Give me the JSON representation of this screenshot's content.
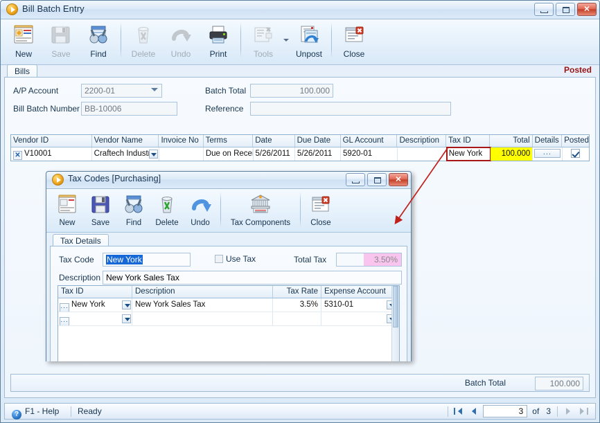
{
  "main_window": {
    "title": "Bill Batch Entry",
    "icon": "app-play-icon",
    "window_controls": {
      "minimize": "–",
      "maximize": "□",
      "close": "✕"
    },
    "toolbar": [
      {
        "label": "New",
        "icon": "new-document-icon",
        "disabled": false
      },
      {
        "label": "Save",
        "icon": "floppy-save-icon",
        "disabled": true
      },
      {
        "label": "Find",
        "icon": "binoculars-icon",
        "disabled": false
      },
      {
        "label": "Delete",
        "icon": "trash-delete-icon",
        "disabled": true
      },
      {
        "label": "Undo",
        "icon": "undo-arrow-icon",
        "disabled": true
      },
      {
        "label": "Print",
        "icon": "printer-icon",
        "disabled": false
      },
      {
        "label": "Tools",
        "icon": "tools-icon",
        "disabled": true
      },
      {
        "label": "Unpost",
        "icon": "unpost-icon",
        "disabled": false
      },
      {
        "label": "Close",
        "icon": "close-window-icon",
        "disabled": false
      }
    ]
  },
  "tab": {
    "label": "Bills",
    "status_flag": "Posted"
  },
  "form": {
    "ap_account_label": "A/P Account",
    "ap_account_value": "2200-01",
    "bill_batch_number_label": "Bill Batch Number",
    "bill_batch_number_value": "BB-10006",
    "batch_total_label": "Batch Total",
    "batch_total_value": "100.000",
    "reference_label": "Reference",
    "reference_value": ""
  },
  "grid": {
    "columns": [
      "Vendor ID",
      "Vendor Name",
      "Invoice No",
      "Terms",
      "Date",
      "Due Date",
      "GL Account",
      "Description",
      "Tax ID",
      "Total",
      "Details",
      "Posted"
    ],
    "rows": [
      {
        "vendor_id": "V10001",
        "vendor_name": "Craftech Industri",
        "invoice_no": "",
        "terms": "Due on Recei",
        "date": "5/26/2011",
        "due_date": "5/26/2011",
        "gl_account": "5920-01",
        "description": "",
        "tax_id": "New York",
        "total": "100.000",
        "details": "...",
        "posted": true
      }
    ]
  },
  "footer": {
    "batch_total_label": "Batch Total",
    "batch_total_value": "100.000"
  },
  "statusbar": {
    "help": "F1 - Help",
    "state": "Ready",
    "nav": {
      "first": "|◀",
      "prev": "◀",
      "current": "3",
      "of_label": "of",
      "total": "3",
      "next": "▶",
      "last": "▶|"
    }
  },
  "dialog": {
    "title": "Tax Codes [Purchasing]",
    "icon": "app-play-icon",
    "toolbar": [
      {
        "label": "New",
        "icon": "new-document-icon",
        "disabled": false
      },
      {
        "label": "Save",
        "icon": "floppy-save-icon",
        "disabled": false
      },
      {
        "label": "Find",
        "icon": "binoculars-icon",
        "disabled": false
      },
      {
        "label": "Delete",
        "icon": "trash-delete-icon",
        "disabled": false
      },
      {
        "label": "Undo",
        "icon": "undo-arrow-icon",
        "disabled": false
      },
      {
        "label": "Tax Components",
        "icon": "bank-columns-icon",
        "disabled": false
      },
      {
        "label": "Close",
        "icon": "close-window-icon",
        "disabled": false
      }
    ],
    "tab": "Tax Details",
    "fields": {
      "tax_code_label": "Tax Code",
      "tax_code_value": "New York",
      "use_tax_label": "Use Tax",
      "use_tax_checked": false,
      "total_tax_label": "Total Tax",
      "total_tax_value": "3.50%",
      "description_label": "Description",
      "description_value": "New York Sales Tax"
    },
    "grid": {
      "columns": [
        "Tax ID",
        "Description",
        "Tax Rate",
        "Expense Account"
      ],
      "rows": [
        {
          "tax_id": "New York",
          "description": "New York Sales Tax",
          "tax_rate": "3.5%",
          "expense_account": "5310-01"
        },
        {
          "tax_id": "",
          "description": "",
          "tax_rate": "",
          "expense_account": ""
        }
      ]
    }
  },
  "annotation": {
    "type": "red-arrow",
    "color": "#c0201a",
    "highlight_box_color": "#a81717",
    "highlight_cell_color": "#ffff00"
  }
}
